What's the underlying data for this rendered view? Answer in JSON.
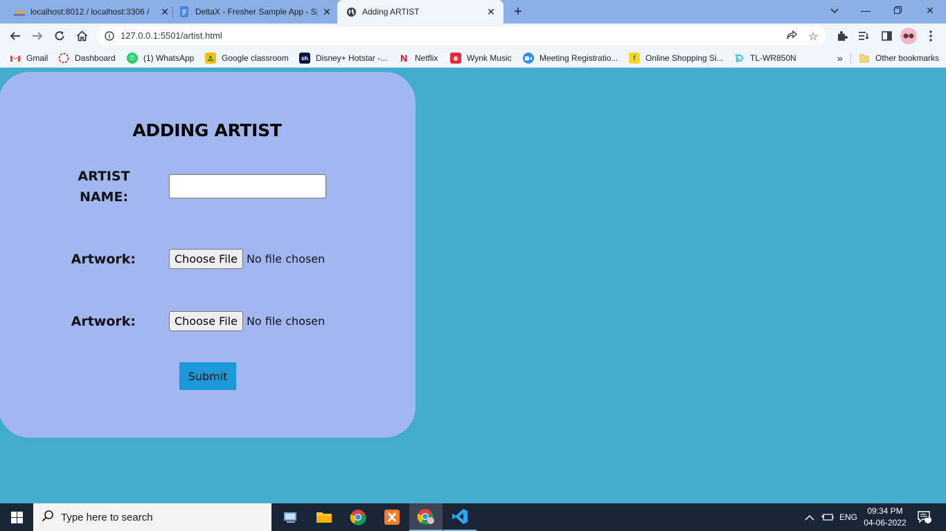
{
  "browser": {
    "tabs": [
      {
        "title": "localhost:8012 / localhost:3306 /",
        "icon": "phpmyadmin-icon"
      },
      {
        "title": "DeltaX - Fresher Sample App - Sp",
        "icon": "google-docs-icon"
      },
      {
        "title": "Adding ARTIST",
        "icon": "globe-icon"
      }
    ],
    "url": "127.0.0.1:5501/artist.html",
    "bookmarks": [
      {
        "label": "Gmail",
        "icon": "gmail-icon"
      },
      {
        "label": "Dashboard",
        "icon": "dashboard-icon"
      },
      {
        "label": "(1) WhatsApp",
        "icon": "whatsapp-icon"
      },
      {
        "label": "Google classroom",
        "icon": "classroom-icon"
      },
      {
        "label": "Disney+ Hotstar -...",
        "icon": "hotstar-icon"
      },
      {
        "label": "Netflix",
        "icon": "netflix-icon"
      },
      {
        "label": "Wynk Music",
        "icon": "wynk-icon"
      },
      {
        "label": "Meeting Registratio...",
        "icon": "zoom-icon"
      },
      {
        "label": "Online Shopping Si...",
        "icon": "flipkart-icon"
      },
      {
        "label": "TL-WR850N",
        "icon": "tplink-icon"
      }
    ],
    "bookmarks_overflow": "»",
    "other_bookmarks": "Other bookmarks"
  },
  "page": {
    "heading": "ADDING ARTIST",
    "artist_name_label_line1": "ARTIST",
    "artist_name_label_line2": "NAME:",
    "artist_name_value": "",
    "artwork_label_1": "Artwork:",
    "artwork_label_2": "Artwork:",
    "choose_file_label": "Choose File",
    "no_file_text": "No file chosen",
    "submit_label": "Submit"
  },
  "taskbar": {
    "search_placeholder": "Type here to search",
    "language": "ENG",
    "time": "09:34 PM",
    "date": "04-06-2022",
    "notification_count": "1"
  },
  "colors": {
    "page_background": "#43abcd",
    "card_background": "#a2b7f1",
    "submit_button": "#1a98d8",
    "tab_strip": "#8aafe6"
  }
}
